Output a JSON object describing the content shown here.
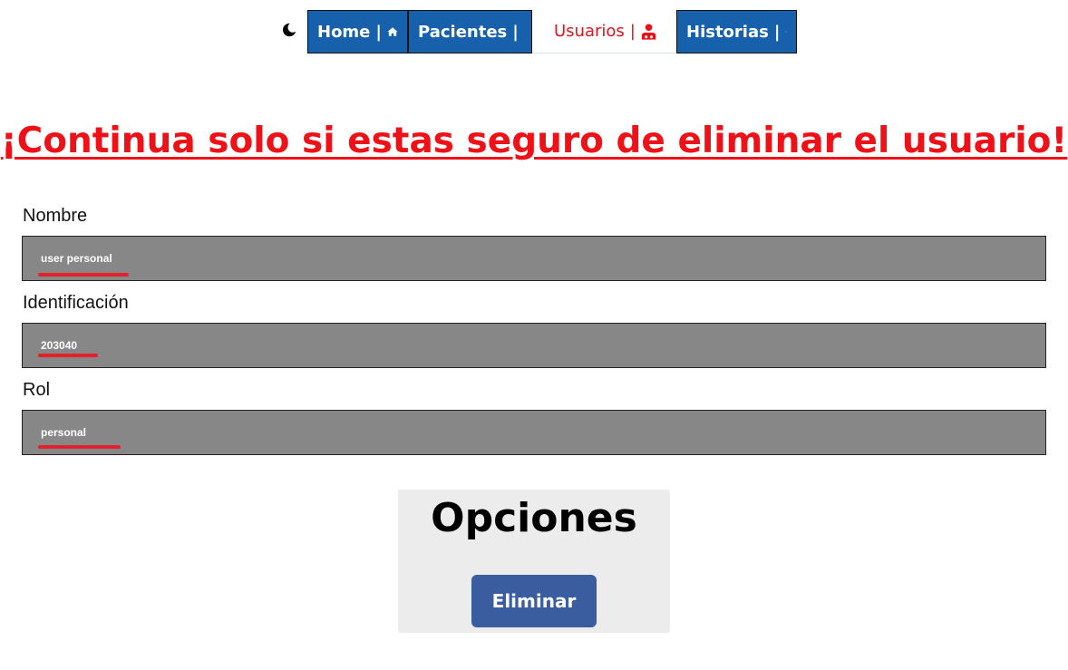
{
  "nav": {
    "tabs": [
      {
        "label": "Home",
        "sep": "|",
        "icon": "home-icon"
      },
      {
        "label": "Pacientes",
        "sep": "|",
        "icon": "patient-icon"
      },
      {
        "label": "Usuarios",
        "sep": "|",
        "icon": "user-doctor-icon",
        "active": true
      },
      {
        "label": "Historias",
        "sep": "|",
        "icon": "folder-user-icon"
      }
    ],
    "theme_icon": "moon-icon"
  },
  "page": {
    "title": "¡Continua solo si estas seguro de eliminar el usuario!"
  },
  "form": {
    "nombre_label": "Nombre",
    "nombre_value": "user personal",
    "identificacion_label": "Identificación",
    "identificacion_value": "203040",
    "rol_label": "Rol",
    "rol_value": "personal"
  },
  "options": {
    "heading": "Opciones",
    "delete_label": "Eliminar"
  },
  "colors": {
    "nav_blue": "#1761ac",
    "danger_red": "#ee1117",
    "field_gray": "#878787",
    "button_blue": "#3a5d9f"
  }
}
